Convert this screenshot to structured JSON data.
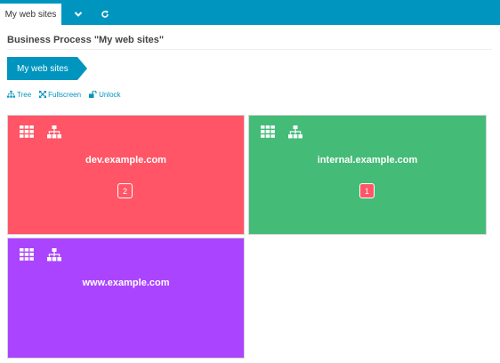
{
  "topbar": {
    "tab_label": "My web sites",
    "color": "#0095bf"
  },
  "page_title": "Business Process \"My web sites\"",
  "breadcrumb": {
    "label": "My web sites"
  },
  "actions": {
    "tree": "Tree",
    "fullscreen": "Fullscreen",
    "unlock": "Unlock"
  },
  "tiles": [
    {
      "title": "dev.example.com",
      "badge": "2",
      "color": "#ff5566",
      "badge_color": "#ff5566"
    },
    {
      "title": "internal.example.com",
      "badge": "1",
      "color": "#44bb77",
      "badge_color": "#ff5566"
    },
    {
      "title": "www.example.com",
      "color": "#aa44ff"
    }
  ],
  "icons": [
    "chevron-down-icon",
    "refresh-icon",
    "tree-icon",
    "fullscreen-icon",
    "unlock-icon",
    "grid-icon",
    "hierarchy-icon"
  ]
}
